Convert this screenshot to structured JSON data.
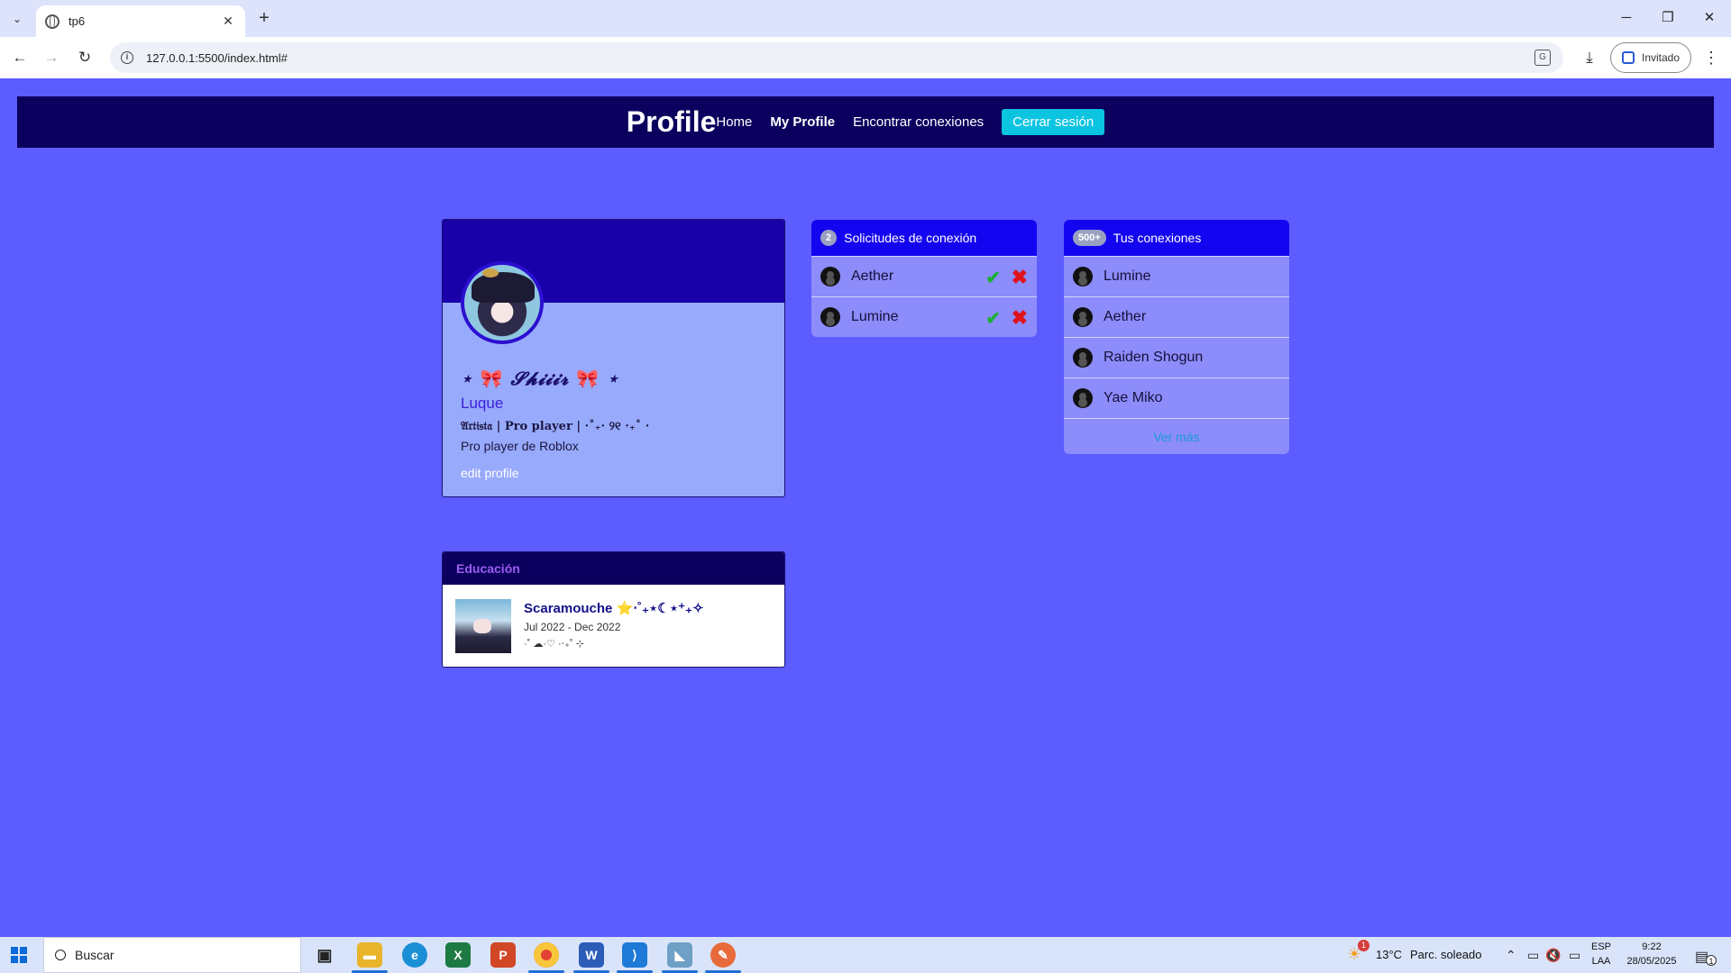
{
  "browser": {
    "tab_title": "tp6",
    "url": "127.0.0.1:5500/index.html#",
    "profile_label": "Invitado"
  },
  "site": {
    "brand": "Profile",
    "nav": {
      "home": "Home",
      "my_profile": "My Profile",
      "connections": "Encontrar conexiones",
      "logout": "Cerrar sesión"
    }
  },
  "profile": {
    "display_name_left": "⋆ ",
    "display_name_bow": "🎀",
    "display_name_text": " 𝓢𝓱𝓲𝓲𝓲𝓻 ",
    "display_name_right": " ⋆",
    "surname": "Luque",
    "headline": "𝔄𝔯𝔱𝔦𝔰𝔱𝔞 | Pro player | ·˚₊· ୨୧ ·₊˚ ·",
    "bio": "Pro player de Roblox",
    "edit_label": "edit profile"
  },
  "requests": {
    "count": "2",
    "title": "Solicitudes de conexión",
    "items": [
      {
        "name": "Aether"
      },
      {
        "name": "Lumine"
      }
    ],
    "accept_glyph": "✔",
    "reject_glyph": "✖"
  },
  "connections": {
    "count": "500+",
    "title": "Tus conexiones",
    "items": [
      {
        "name": "Lumine"
      },
      {
        "name": "Aether"
      },
      {
        "name": "Raiden Shogun"
      },
      {
        "name": "Yae Miko"
      }
    ],
    "see_more": "Ver más"
  },
  "education": {
    "header": "Educación",
    "title": "Scaramouche ⭐‧˚₊⋆☾⋆⁺₊✧",
    "dates": "Jul 2022 - Dec 2022",
    "description": "·˚ ☁·♡ ·‧₊˚ ⊹"
  },
  "taskbar": {
    "search_placeholder": "Buscar",
    "weather_temp": "13°C",
    "weather_desc": "Parc. soleado",
    "lang_top": "ESP",
    "lang_bottom": "LAA",
    "time": "9:22",
    "date": "28/05/2025",
    "weather_badge": "1",
    "notif_badge": "1"
  },
  "colors": {
    "page_bg": "#5c5cff",
    "nav_bg": "#0b005e",
    "logout_bg": "#0ac4e0",
    "panel_header": "#1405f0",
    "accept": "#1fae3a",
    "reject": "#e0131b"
  }
}
